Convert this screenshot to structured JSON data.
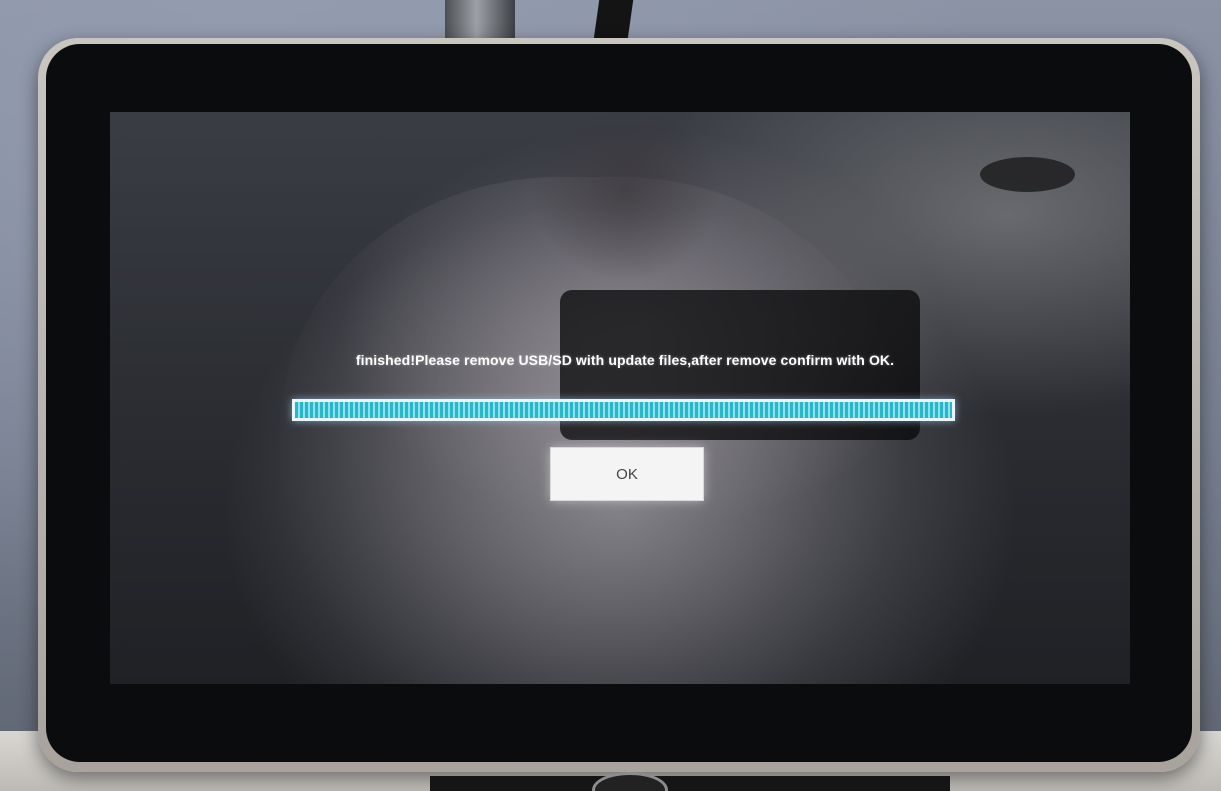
{
  "dialog": {
    "message": "finished!Please remove USB/SD with update files,after remove confirm with OK.",
    "progress_percent": 100,
    "ok_label": "OK"
  },
  "colors": {
    "message_text": "#ffffff",
    "progress_fill": "#2ab6c8",
    "progress_border": "#e9f6ff",
    "button_background": "#f4f4f4"
  }
}
